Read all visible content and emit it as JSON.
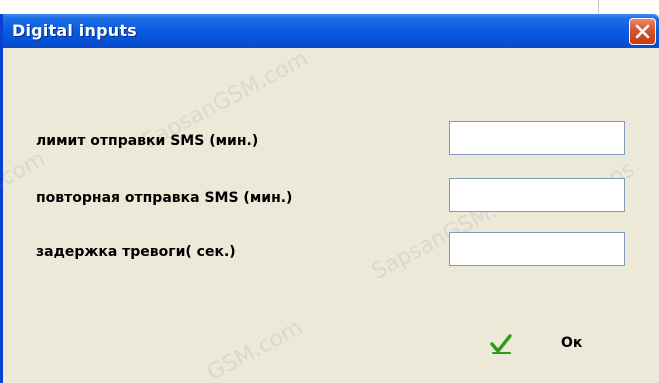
{
  "dialog": {
    "title": "Digital inputs",
    "close_symbol": "✕"
  },
  "fields": [
    {
      "label": "лимит отправки SMS (мин.)",
      "value": "",
      "placeholder": ""
    },
    {
      "label": "повторная отправка SMS (мин.)",
      "value": "",
      "placeholder": ""
    },
    {
      "label": "задержка тревоги( сек.)",
      "value": "",
      "placeholder": ""
    }
  ],
  "ok_button": {
    "label": "Ок",
    "icon": "checkmark-icon"
  },
  "colors": {
    "title_bar": "#0a5de0",
    "close_button": "#d8542b",
    "dialog_bg": "#ece9d8",
    "check_green": "#2e9a1a"
  }
}
